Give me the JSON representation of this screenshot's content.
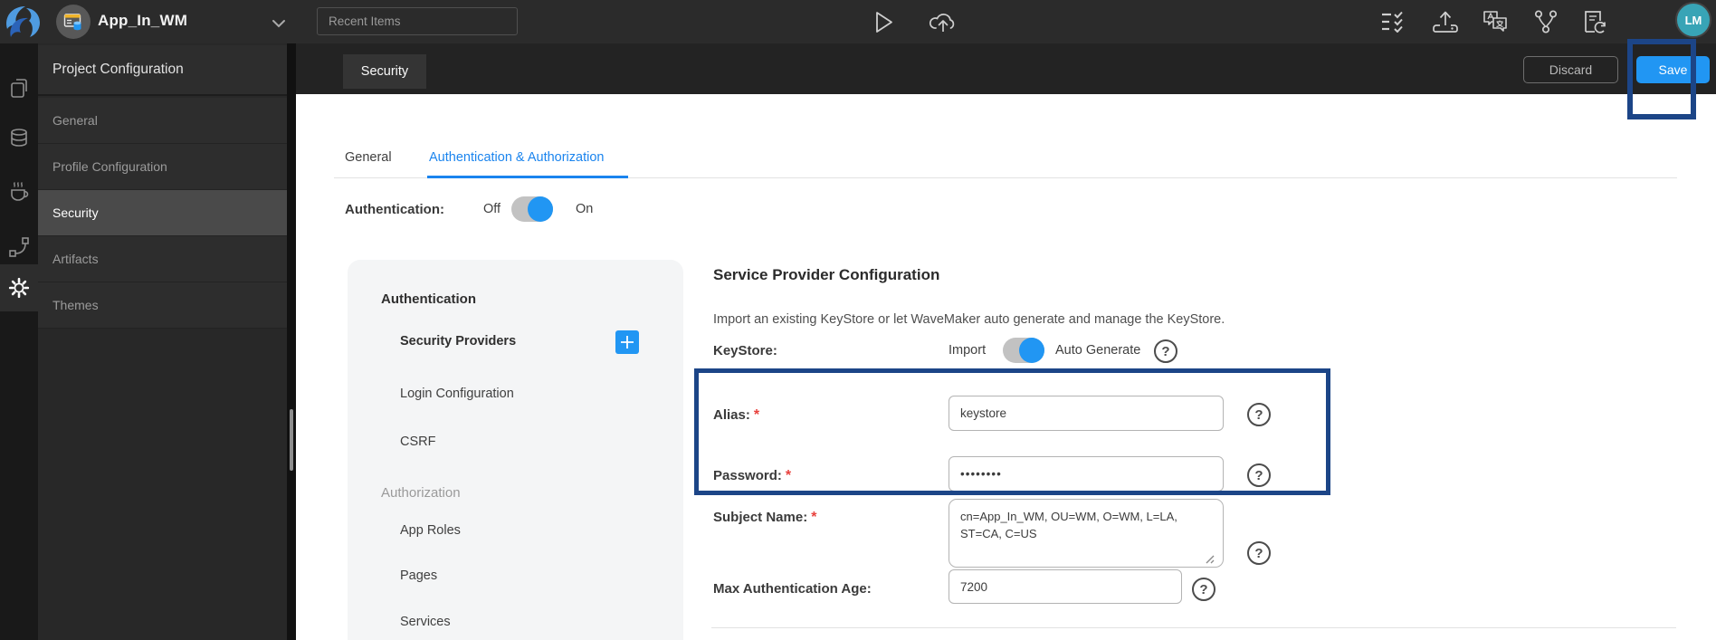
{
  "topbar": {
    "app_name": "App_In_WM",
    "search_placeholder": "Recent Items",
    "avatar": "LM"
  },
  "window": {
    "page_tab": "Security",
    "discard": "Discard",
    "save": "Save"
  },
  "sidebar": {
    "title": "Project Configuration",
    "items": [
      {
        "label": "General",
        "selected": false
      },
      {
        "label": "Profile Configuration",
        "selected": false
      },
      {
        "label": "Security",
        "selected": true
      },
      {
        "label": "Artifacts",
        "selected": false
      },
      {
        "label": "Themes",
        "selected": false
      }
    ]
  },
  "tabs": {
    "general": "General",
    "auth": "Authentication & Authorization"
  },
  "authentication": {
    "label": "Authentication:",
    "off": "Off",
    "on": "On",
    "state": "on"
  },
  "subnav": {
    "auth_title": "Authentication",
    "items_auth": [
      "Security Providers",
      "Login Configuration",
      "CSRF"
    ],
    "authz_title": "Authorization",
    "items_authz": [
      "App Roles",
      "Pages",
      "Services"
    ],
    "active_item": "Security Providers"
  },
  "content": {
    "heading": "Service Provider Configuration",
    "description": "Import an existing KeyStore or let WaveMaker auto generate and manage the KeyStore.",
    "keystore_label": "KeyStore:",
    "keystore_off": "Import",
    "keystore_on": "Auto Generate",
    "keystore_state": "auto-generate",
    "fields": [
      {
        "label": "Alias:",
        "required": true,
        "value": "keystore"
      },
      {
        "label": "Password:",
        "required": true,
        "value": "••••••••"
      },
      {
        "label": "Subject Name:",
        "required": true,
        "value": "cn=App_In_WM, OU=WM, O=WM, L=LA, ST=CA, C=US"
      },
      {
        "label": "Max Authentication Age:",
        "required": false,
        "value": "7200"
      }
    ]
  },
  "ui": {
    "required_marker": "*"
  },
  "icons": {
    "help": "?",
    "names": [
      "wavemaker-logo",
      "app-icon",
      "chevron-down",
      "run-play",
      "cloud-deploy",
      "checklist",
      "export-drive",
      "translate",
      "branch",
      "file-sync",
      "pages",
      "database",
      "java-services",
      "apis-connector",
      "settings-gear",
      "plus",
      "question-help"
    ]
  },
  "colors": {
    "accent_blue": "#2196f3",
    "tab_active_blue": "#1a84ee",
    "annotation_navy": "#1c4587",
    "avatar_teal": "#38a4b6",
    "panel_gray": "#f4f5f6",
    "topbar_dark": "#2b2b2b"
  }
}
